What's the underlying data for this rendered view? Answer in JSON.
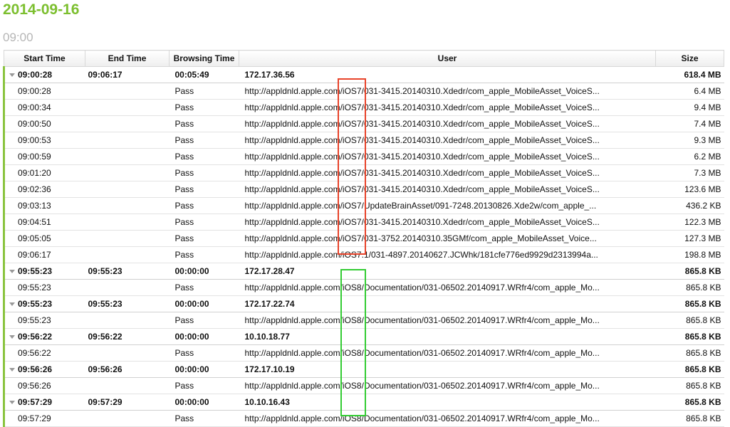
{
  "header": {
    "date": "2014-09-16",
    "hour": "09:00"
  },
  "columns": {
    "start": "Start Time",
    "end": "End Time",
    "browsing": "Browsing Time",
    "user": "User",
    "size": "Size"
  },
  "groups": [
    {
      "start": "09:00:28",
      "end": "09:06:17",
      "browsing": "00:05:49",
      "user": "172.17.36.56",
      "size": "618.4 MB",
      "rows": [
        {
          "start": "09:00:28",
          "browsing": "Pass",
          "url": "http://appldnld.apple.com/iOS7/031-3415.20140310.Xdedr/com_apple_MobileAsset_VoiceS...",
          "size": "6.4 MB"
        },
        {
          "start": "09:00:34",
          "browsing": "Pass",
          "url": "http://appldnld.apple.com/iOS7/031-3415.20140310.Xdedr/com_apple_MobileAsset_VoiceS...",
          "size": "9.4 MB"
        },
        {
          "start": "09:00:50",
          "browsing": "Pass",
          "url": "http://appldnld.apple.com/iOS7/031-3415.20140310.Xdedr/com_apple_MobileAsset_VoiceS...",
          "size": "7.4 MB"
        },
        {
          "start": "09:00:53",
          "browsing": "Pass",
          "url": "http://appldnld.apple.com/iOS7/031-3415.20140310.Xdedr/com_apple_MobileAsset_VoiceS...",
          "size": "9.3 MB"
        },
        {
          "start": "09:00:59",
          "browsing": "Pass",
          "url": "http://appldnld.apple.com/iOS7/031-3415.20140310.Xdedr/com_apple_MobileAsset_VoiceS...",
          "size": "6.2 MB"
        },
        {
          "start": "09:01:20",
          "browsing": "Pass",
          "url": "http://appldnld.apple.com/iOS7/031-3415.20140310.Xdedr/com_apple_MobileAsset_VoiceS...",
          "size": "7.3 MB"
        },
        {
          "start": "09:02:36",
          "browsing": "Pass",
          "url": "http://appldnld.apple.com/iOS7/031-3415.20140310.Xdedr/com_apple_MobileAsset_VoiceS...",
          "size": "123.6 MB"
        },
        {
          "start": "09:03:13",
          "browsing": "Pass",
          "url": "http://appldnld.apple.com/iOS7/UpdateBrainAsset/091-7248.20130826.Xde2w/com_apple_...",
          "size": "436.2 KB"
        },
        {
          "start": "09:04:51",
          "browsing": "Pass",
          "url": "http://appldnld.apple.com/iOS7/031-3415.20140310.Xdedr/com_apple_MobileAsset_VoiceS...",
          "size": "122.3 MB"
        },
        {
          "start": "09:05:05",
          "browsing": "Pass",
          "url": "http://appldnld.apple.com/iOS7/031-3752.20140310.35GMf/com_apple_MobileAsset_Voice...",
          "size": "127.3 MB"
        },
        {
          "start": "09:06:17",
          "browsing": "Pass",
          "url": "http://appldnld.apple.com/iOS7.1/031-4897.20140627.JCWhk/181cfe776ed9929d2313994a...",
          "size": "198.8 MB"
        }
      ]
    },
    {
      "start": "09:55:23",
      "end": "09:55:23",
      "browsing": "00:00:00",
      "user": "172.17.28.47",
      "size": "865.8 KB",
      "rows": [
        {
          "start": "09:55:23",
          "browsing": "Pass",
          "url": "http://appldnld.apple.com/iOS8/Documentation/031-06502.20140917.WRfr4/com_apple_Mo...",
          "size": "865.8 KB"
        }
      ]
    },
    {
      "start": "09:55:23",
      "end": "09:55:23",
      "browsing": "00:00:00",
      "user": "172.17.22.74",
      "size": "865.8 KB",
      "rows": [
        {
          "start": "09:55:23",
          "browsing": "Pass",
          "url": "http://appldnld.apple.com/iOS8/Documentation/031-06502.20140917.WRfr4/com_apple_Mo...",
          "size": "865.8 KB"
        }
      ]
    },
    {
      "start": "09:56:22",
      "end": "09:56:22",
      "browsing": "00:00:00",
      "user": "10.10.18.77",
      "size": "865.8 KB",
      "rows": [
        {
          "start": "09:56:22",
          "browsing": "Pass",
          "url": "http://appldnld.apple.com/iOS8/Documentation/031-06502.20140917.WRfr4/com_apple_Mo...",
          "size": "865.8 KB"
        }
      ]
    },
    {
      "start": "09:56:26",
      "end": "09:56:26",
      "browsing": "00:00:00",
      "user": "172.17.10.19",
      "size": "865.8 KB",
      "rows": [
        {
          "start": "09:56:26",
          "browsing": "Pass",
          "url": "http://appldnld.apple.com/iOS8/Documentation/031-06502.20140917.WRfr4/com_apple_Mo...",
          "size": "865.8 KB"
        }
      ]
    },
    {
      "start": "09:57:29",
      "end": "09:57:29",
      "browsing": "00:00:00",
      "user": "10.10.16.43",
      "size": "865.8 KB",
      "rows": [
        {
          "start": "09:57:29",
          "browsing": "Pass",
          "url": "http://appldnld.apple.com/iOS8/Documentation/031-06502.20140917.WRfr4/com_apple_Mo...",
          "size": "865.8 KB"
        }
      ]
    }
  ],
  "colors": {
    "accent": "#7cbf2f",
    "highlight_red": "#e8432a",
    "highlight_green": "#33cc33"
  }
}
